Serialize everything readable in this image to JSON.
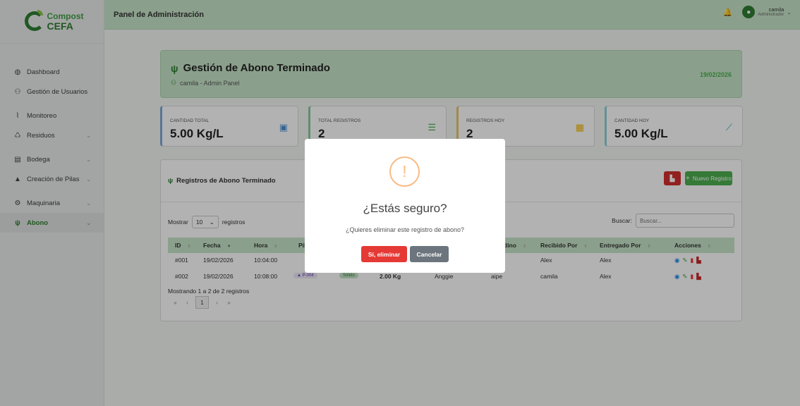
{
  "brand": {
    "line1": "Compost",
    "line2": "CEFA"
  },
  "topbar": {
    "title": "Panel de Administración",
    "user_name": "camila",
    "user_role": "Administrador"
  },
  "sidebar": {
    "items": [
      {
        "label": "Dashboard",
        "icon": "dashboard-icon"
      },
      {
        "label": "Gestión de Usuarios",
        "icon": "users-icon"
      },
      {
        "label": "Monitoreo",
        "icon": "chart-icon"
      },
      {
        "label": "Residuos",
        "icon": "recycle-icon"
      },
      {
        "label": "Bodega",
        "icon": "warehouse-icon"
      },
      {
        "label": "Creación de Pilas",
        "icon": "triangle-icon"
      },
      {
        "label": "Maquinaria",
        "icon": "cogs-icon"
      },
      {
        "label": "Abono",
        "icon": "seedling-icon"
      }
    ]
  },
  "hero": {
    "title": "Gestión de Abono Terminado",
    "subtitle": "camila - Admin Panel",
    "date": "19/02/2026"
  },
  "stats": [
    {
      "label": "Cantidad Total",
      "value": "5.00 Kg/L",
      "icon": "box-icon",
      "color": "#4a90d9"
    },
    {
      "label": "Total Registros",
      "value": "2",
      "icon": "list-icon",
      "color": "#4caf50"
    },
    {
      "label": "Registros Hoy",
      "value": "2",
      "icon": "calendar-icon",
      "color": "#f5b800"
    },
    {
      "label": "Cantidad Hoy",
      "value": "5.00 Kg/L",
      "icon": "chart-line-icon",
      "color": "#26a6b8"
    }
  ],
  "panel": {
    "title": "Registros de Abono Terminado",
    "new_button": "Nuevo Registro",
    "length_prefix": "Mostrar",
    "length_value": "10",
    "length_suffix": "registros",
    "search_label": "Buscar:",
    "search_placeholder": "Buscar...",
    "info": "Mostrando 1 a 2 de 2 registros",
    "current_page": "1"
  },
  "table": {
    "columns": [
      "ID",
      "Fecha",
      "Hora",
      "Pila",
      "dino",
      "Recibido Por",
      "Entregado Por",
      "Acciones"
    ],
    "rows": [
      {
        "id": "#001",
        "fecha": "19/02/2026",
        "hora": "10:04:00",
        "recibido": "Alex",
        "entregado": "Alex"
      },
      {
        "id": "#002",
        "fecha": "19/02/2026",
        "hora": "10:08:00",
        "pila": "P-004",
        "tipo": "Sólido",
        "cantidad": "2.00 Kg",
        "col6": "Anggie",
        "destino": "aipe",
        "recibido": "camila",
        "entregado": "Alex"
      }
    ]
  },
  "modal": {
    "icon": "!",
    "title": "¿Estás seguro?",
    "text": "¿Quieres eliminar este registro de abono?",
    "confirm": "Sí, eliminar",
    "cancel": "Cancelar"
  },
  "colors": {
    "primary_green": "#2e7d32",
    "header_green": "#c8e6c9",
    "danger": "#e53935",
    "warning_ring": "#f8bb86"
  }
}
